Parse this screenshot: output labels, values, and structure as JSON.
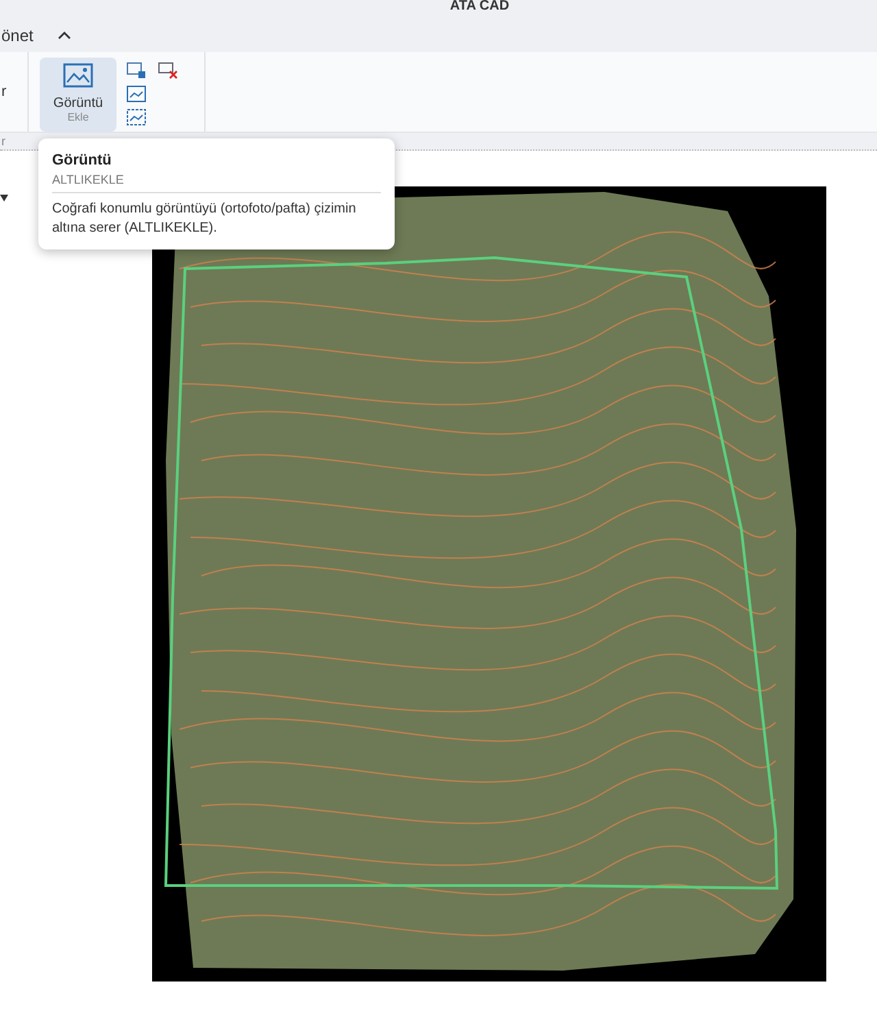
{
  "window": {
    "title": "ATA CAD"
  },
  "tabs": [
    {
      "label": "önet",
      "selected": false
    }
  ],
  "ribbon": {
    "left_group": {
      "button_label": "r",
      "group_label": "r"
    },
    "image_button": {
      "label": "Görüntü",
      "sublabel": "Ekle",
      "selected": true
    }
  },
  "tooltip": {
    "title": "Görüntü",
    "command": "ALTLIKEKLE",
    "description": "Coğrafi konumlu görüntüyü (ortofoto/pafta) çizimin altına serer (ALTLIKEKLE)."
  }
}
